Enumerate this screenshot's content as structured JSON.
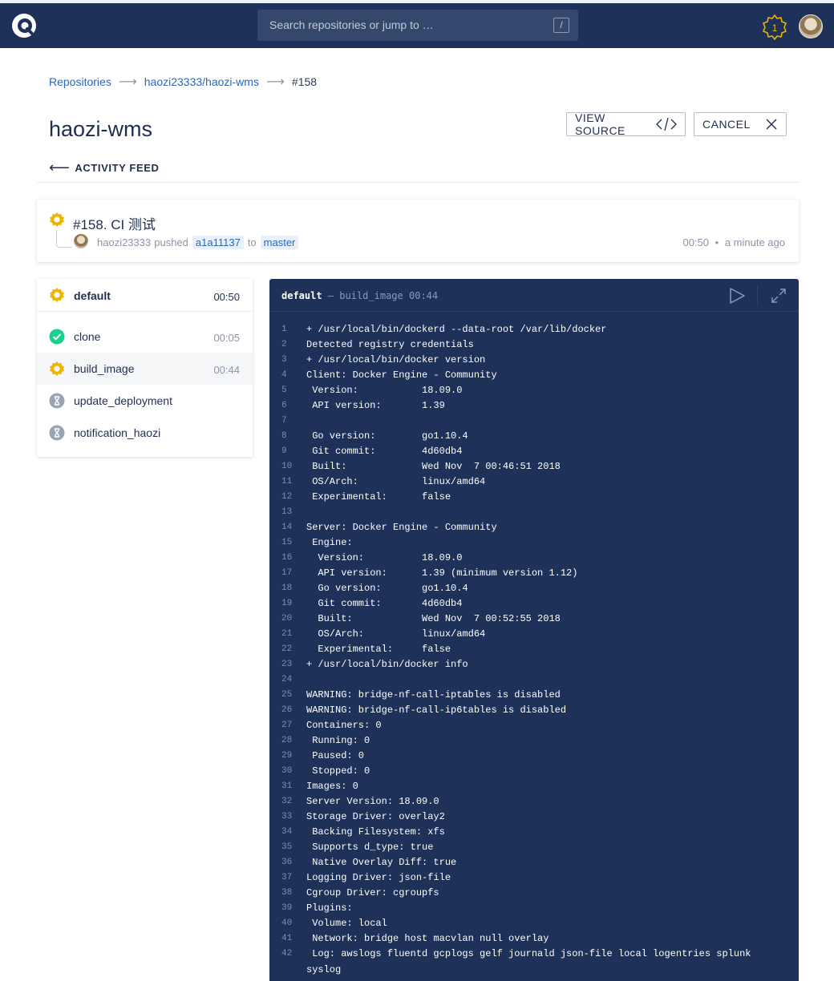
{
  "header": {
    "search_placeholder": "Search repositories or jump to …",
    "search_shortcut": "/",
    "notification_count": "1"
  },
  "breadcrumb": {
    "items": [
      "Repositories",
      "haozi23333/haozi-wms",
      "#158"
    ]
  },
  "repo": {
    "title": "haozi-wms",
    "view_source_label": "VIEW SOURCE",
    "cancel_label": "CANCEL",
    "activity_feed_label": "ACTIVITY FEED"
  },
  "build": {
    "title": "#158. CI 测试",
    "author": "haozi23333",
    "action": "pushed",
    "commit": "a1a11137",
    "to_word": "to",
    "branch": "master",
    "duration": "00:50",
    "separator": "•",
    "ago": "a minute ago",
    "status_color": "#f0b400"
  },
  "stages": {
    "name": "default",
    "duration": "00:50",
    "steps": [
      {
        "name": "clone",
        "duration": "00:05",
        "status": "success"
      },
      {
        "name": "build_image",
        "duration": "00:44",
        "status": "running"
      },
      {
        "name": "update_deployment",
        "duration": "",
        "status": "pending"
      },
      {
        "name": "notification_haozi",
        "duration": "",
        "status": "pending"
      }
    ]
  },
  "console": {
    "stage": "default",
    "dash": "—",
    "step": "build_image",
    "duration": "00:44",
    "lines": [
      "+ /usr/local/bin/dockerd --data-root /var/lib/docker",
      "Detected registry credentials",
      "+ /usr/local/bin/docker version",
      "Client: Docker Engine - Community",
      " Version:           18.09.0",
      " API version:       1.39",
      "",
      " Go version:        go1.10.4",
      " Git commit:        4d60db4",
      " Built:             Wed Nov  7 00:46:51 2018",
      " OS/Arch:           linux/amd64",
      " Experimental:      false",
      "",
      "Server: Docker Engine - Community",
      " Engine:",
      "  Version:          18.09.0",
      "  API version:      1.39 (minimum version 1.12)",
      "  Go version:       go1.10.4",
      "  Git commit:       4d60db4",
      "  Built:            Wed Nov  7 00:52:55 2018",
      "  OS/Arch:          linux/amd64",
      "  Experimental:     false",
      "+ /usr/local/bin/docker info",
      "",
      "WARNING: bridge-nf-call-iptables is disabled",
      "WARNING: bridge-nf-call-ip6tables is disabled",
      "Containers: 0",
      " Running: 0",
      " Paused: 0",
      " Stopped: 0",
      "Images: 0",
      "Server Version: 18.09.0",
      "Storage Driver: overlay2",
      " Backing Filesystem: xfs",
      " Supports d_type: true",
      " Native Overlay Diff: true",
      "Logging Driver: json-file",
      "Cgroup Driver: cgroupfs",
      "Plugins:",
      " Volume: local",
      " Network: bridge host macvlan null overlay",
      " Log: awslogs fluentd gcplogs gelf journald json-file local logentries splunk"
    ],
    "wrapped_tail": "syslog"
  }
}
